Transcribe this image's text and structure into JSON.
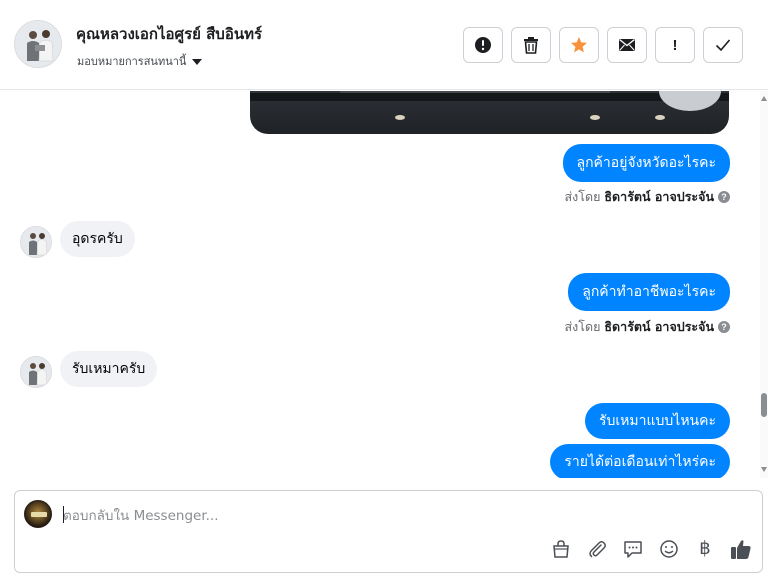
{
  "header": {
    "contact_name": "คุณหลวงเอกไอศูรย์ สืบอินทร์",
    "assign_label": "มอบหมายการสนทนานี้",
    "actions": [
      {
        "name": "spam-button",
        "icon": "alert-circle-icon"
      },
      {
        "name": "delete-button",
        "icon": "trash-icon"
      },
      {
        "name": "star-button",
        "icon": "star-icon",
        "color": "#f7923a"
      },
      {
        "name": "mark-unread-button",
        "icon": "envelope-icon"
      },
      {
        "name": "follow-up-button",
        "icon": "exclamation-icon",
        "text": "!"
      },
      {
        "name": "mark-done-button",
        "icon": "checkmark-icon"
      }
    ]
  },
  "messages": [
    {
      "direction": "out",
      "text": "ลูกค้าอยู่จังหวัดอะไรคะ",
      "sent_by_prefix": "ส่งโดย",
      "sent_by_name": "ธิดารัตน์ อาจประจัน"
    },
    {
      "direction": "in",
      "text": "อุดรครับ"
    },
    {
      "direction": "out",
      "text": "ลูกค้าทำอาชีพอะไรคะ",
      "sent_by_prefix": "ส่งโดย",
      "sent_by_name": "ธิดารัตน์ อาจประจัน"
    },
    {
      "direction": "in",
      "text": "รับเหมาครับ"
    },
    {
      "direction": "out",
      "text": "รับเหมาแบบไหนคะ"
    },
    {
      "direction": "out",
      "text": "รายได้ต่อเดือนเท่าไหร่คะ"
    }
  ],
  "composer": {
    "placeholder": "ตอบกลับใน Messenger..."
  },
  "colors": {
    "outgoing_bubble": "#0084ff",
    "incoming_bubble": "#f0f2f5",
    "star": "#f7923a"
  }
}
